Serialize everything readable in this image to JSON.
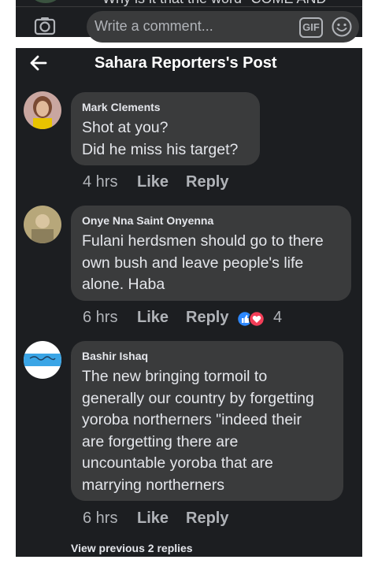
{
  "top_bar": {
    "previous_text": "Why is it that the word \"COME AND",
    "comment_placeholder": "Write a comment...",
    "gif_label": "GIF"
  },
  "header": {
    "title": "Sahara Reporters's Post"
  },
  "comments": [
    {
      "author": "Mark Clements",
      "lines": [
        "Shot at you?",
        "Did he miss his target?"
      ],
      "time": "4 hrs",
      "like": "Like",
      "reply": "Reply"
    },
    {
      "author": "Onye Nna Saint Onyenna",
      "lines": [
        "Fulani herdsmen should go to there",
        "own bush and leave people's life",
        "alone. Haba"
      ],
      "time": "6 hrs",
      "like": "Like",
      "reply": "Reply",
      "reaction_count": "4"
    },
    {
      "author": "Bashir Ishaq",
      "lines": [
        "The new bringing tormoil to",
        "generally our country by forgetting",
        "yoroba northerners \"indeed their",
        "are forgetting there are",
        "uncountable yoroba that are",
        "marrying northerners"
      ],
      "time": "6 hrs",
      "like": "Like",
      "reply": "Reply"
    }
  ],
  "view_previous": "View previous 2 replies",
  "colors": {
    "background": "#1c1e21",
    "bubble": "#3a3b3c",
    "text": "#e4e6eb",
    "meta": "#b0b3b8",
    "like_blue": "#2d88ff",
    "love_red": "#f33e58"
  }
}
